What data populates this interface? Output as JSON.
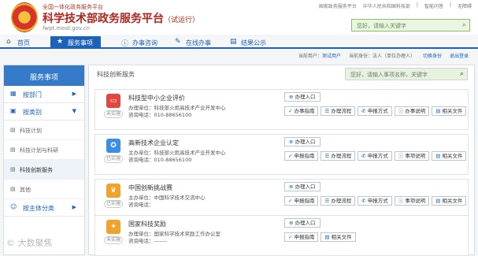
{
  "header": {
    "portal_subtitle": "全国一体化政务服务平台",
    "title": "科学技术部政务服务平台",
    "trial": "（试运行）",
    "url": "fwpt.most.gov.cn",
    "top_links": [
      "国家政务服务平台",
      "中华人民共和国科技部",
      "|",
      "智能问答",
      "|",
      "无障碍"
    ],
    "search_placeholder": "您好，请输入关键字"
  },
  "nav": {
    "items": [
      {
        "label": "首页",
        "icon": "home-icon"
      },
      {
        "label": "服务事项",
        "icon": "star-icon",
        "active": true
      },
      {
        "label": "办事咨询",
        "icon": "info-icon"
      },
      {
        "label": "在线办事",
        "icon": "edit-icon"
      },
      {
        "label": "结果公示",
        "icon": "list-icon"
      }
    ]
  },
  "userbar": {
    "current_user_label": "当前用户：",
    "current_user": "测试用户",
    "identity_label": "当前身份：法人（单位办理人）",
    "switch_identity": "切换身份",
    "logout": "退出登录"
  },
  "sidebar": {
    "header": "服务事项",
    "items": [
      {
        "label": "按部门",
        "icon": "building-icon",
        "expanded": false
      },
      {
        "label": "按类别",
        "icon": "grid-icon",
        "expanded": true
      }
    ],
    "sub_items": [
      "科技计划",
      "科技计划与科研",
      "科技创新服务",
      "其他"
    ],
    "active_sub_index": 2,
    "extra_items": [
      {
        "label": "按主体分类",
        "icon": "people-icon"
      }
    ]
  },
  "main": {
    "section_title": "科技创新服务",
    "search_placeholder": "您好，请输入事项名称，关键字",
    "start_label": "办理入口",
    "cards": [
      {
        "name": "科技型中小企业评价",
        "dept": "办理单位：科技部火炬高技术产业开发中心",
        "phone": "咨询电话：010-88656100",
        "tag": "未实施",
        "icon_color": "#e2463d",
        "icon": "monitor-icon",
        "buttons": [
          "办事指南",
          "办理流程",
          "申报方式",
          "办事说明",
          "相关文件"
        ]
      },
      {
        "name": "高新技术企业认定",
        "dept": "主办单位：科技部火炬高技术产业开发中心",
        "phone": "咨询电话：010-88656100",
        "tag": "已实施",
        "icon_color": "#3a8ee6",
        "icon": "award-icon",
        "buttons": [
          "申报指南",
          "办理流程",
          "申报方式",
          "事项说明",
          "相关文件"
        ]
      },
      {
        "name": "中国创新挑战赛",
        "dept": "主办单位：中国科学技术交流中心",
        "phone": "咨询电话：",
        "tag": "已实施",
        "icon_color": "#f0a22b",
        "icon": "trophy-icon",
        "buttons": [
          "申报指南",
          "办理流程",
          "申报方式",
          "事项说明",
          "相关文件"
        ]
      },
      {
        "name": "国家科技奖励",
        "dept": "办理单位：国家科学技术奖励工作办公室",
        "phone": "咨询电话：-------",
        "tag": "未实施",
        "icon_color": "#f0a22b",
        "icon": "medal-icon",
        "buttons": [
          "申报指南",
          "相关文件"
        ]
      }
    ]
  },
  "watermark": "大数聚焦"
}
